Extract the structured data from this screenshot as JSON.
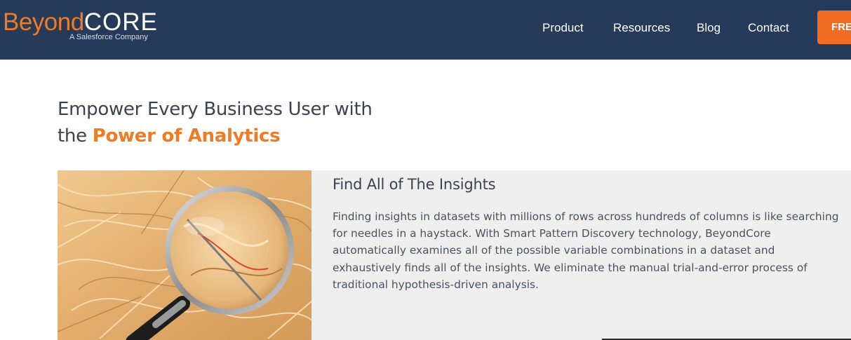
{
  "header": {
    "logo": {
      "word_part1": "Beyond",
      "word_part2": "CORE",
      "tagline": "A Salesforce Company"
    },
    "nav": {
      "product": "Product",
      "resources": "Resources",
      "blog": "Blog",
      "contact": "Contact"
    },
    "cta_label": "FREE"
  },
  "hero": {
    "line1": "Empower Every Business User with",
    "line2_prefix": "the ",
    "line2_accent": "Power of Analytics"
  },
  "feature": {
    "title": "Find All of The Insights",
    "body": "Finding insights in datasets with millions of rows across hundreds of columns is like searching for needles in a haystack. With Smart Pattern Discovery technology, BeyondCore automatically examines all of the possible variable combinations in a dataset and exhaustively finds all of the insights. We eliminate the manual trial-and-error process of traditional hypothesis-driven analysis."
  },
  "colors": {
    "header_bg": "#263a5a",
    "brand_orange": "#ef7b24",
    "cta_orange": "#ef6c22",
    "feature_bg": "#efefef",
    "text_dark": "#3b4250"
  }
}
